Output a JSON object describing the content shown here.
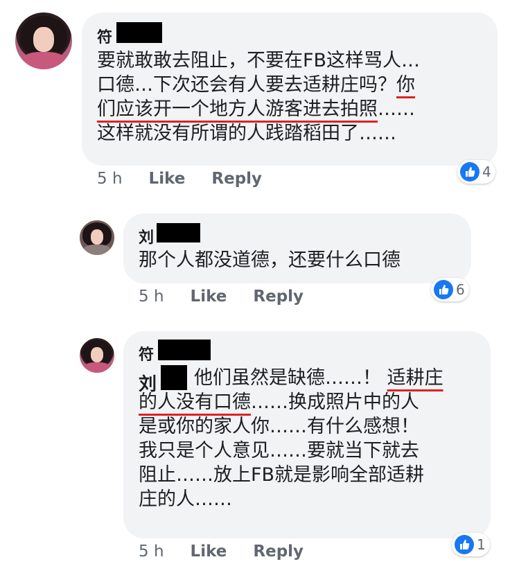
{
  "comments": [
    {
      "name": "符",
      "lines": [
        {
          "parts": [
            {
              "text": "要就敢敢去阻止，不要在FB这样骂人…",
              "ul": false
            }
          ]
        },
        {
          "parts": [
            {
              "text": "口德…下次还会有人要去适耕庄吗？",
              "ul": false
            },
            {
              "text": "你",
              "ul": true
            }
          ]
        },
        {
          "parts": [
            {
              "text": "们应该开一个地方人游客进去拍照",
              "ul": true
            },
            {
              "text": "……",
              "ul": false
            }
          ]
        },
        {
          "parts": [
            {
              "text": "这样就没有所谓的人践踏稻田了……",
              "ul": false
            }
          ]
        }
      ],
      "time": "5 h",
      "like": "Like",
      "reply": "Reply",
      "reaction_count": "4"
    },
    {
      "name": "刘",
      "lines": [
        {
          "parts": [
            {
              "text": "那个人都没道德，还要什么口德",
              "ul": false
            }
          ]
        }
      ],
      "time": "5 h",
      "like": "Like",
      "reply": "Reply",
      "reaction_count": "6"
    },
    {
      "name": "符",
      "mention": "刘",
      "lines": [
        {
          "parts": [
            {
              "text": "他们虽然是缺德……！ ",
              "ul": false
            },
            {
              "text": "适耕庄",
              "ul": true
            }
          ]
        },
        {
          "parts": [
            {
              "text": "的人没有口德",
              "ul": true
            },
            {
              "text": "……换成照片中的人",
              "ul": false
            }
          ]
        },
        {
          "parts": [
            {
              "text": "是或你的家人你……有什么感想！",
              "ul": false
            }
          ]
        },
        {
          "parts": [
            {
              "text": "我只是个人意见……要就当下就去",
              "ul": false
            }
          ]
        },
        {
          "parts": [
            {
              "text": "阻止……放上FB就是影响全部适耕",
              "ul": false
            }
          ]
        },
        {
          "parts": [
            {
              "text": "庄的人……",
              "ul": false
            }
          ]
        }
      ],
      "time": "5 h",
      "like": "Like",
      "reply": "Reply",
      "reaction_count": "1"
    }
  ],
  "colors": {
    "bubble": "#f2f3f5",
    "like_blue": "#1877f2",
    "underline_red": "#e0201f",
    "meta_gray": "#606770"
  },
  "icons": {
    "reaction": "thumbs-up-icon"
  }
}
